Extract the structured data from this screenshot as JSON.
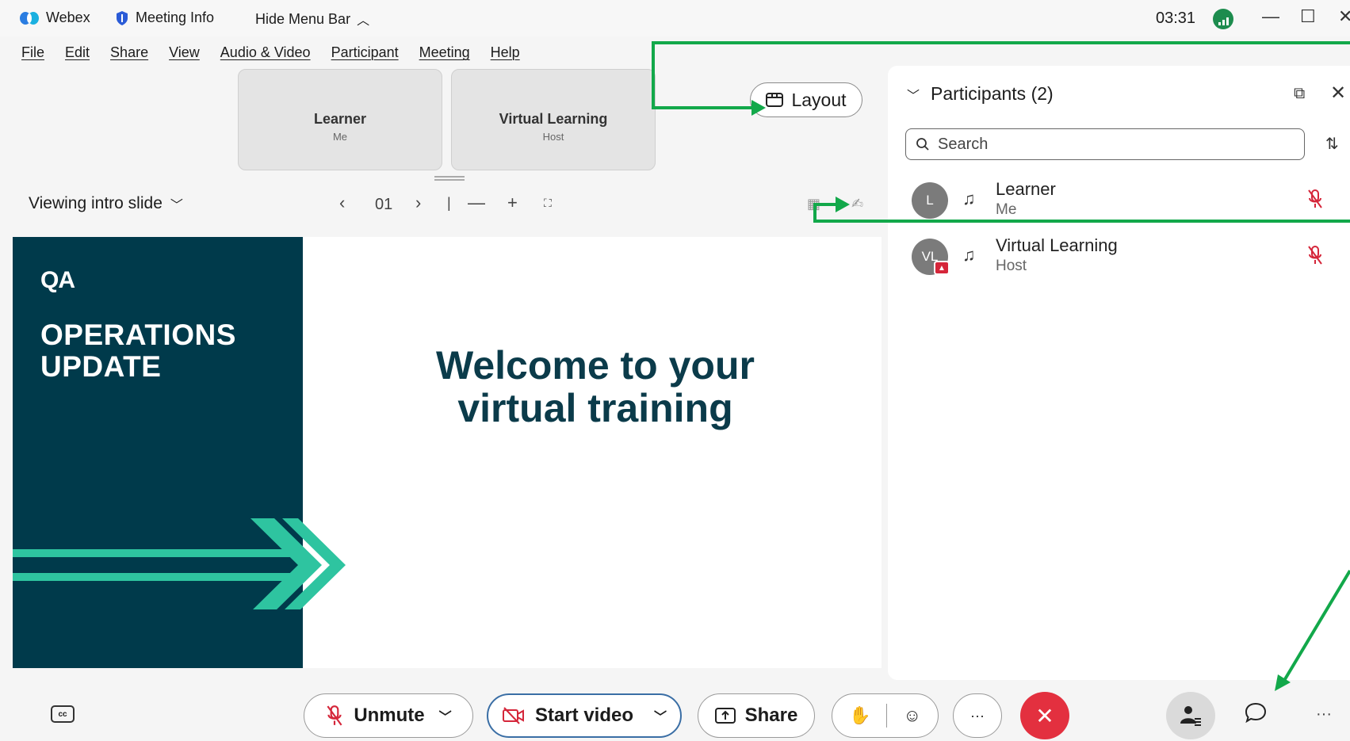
{
  "titlebar": {
    "app_name": "Webex",
    "meeting_info": "Meeting Info",
    "hide_menu": "Hide Menu Bar",
    "clock": "03:31"
  },
  "menu": [
    "File",
    "Edit",
    "Share",
    "View",
    "Audio & Video",
    "Participant",
    "Meeting",
    "Help"
  ],
  "tiles": [
    {
      "name": "Learner",
      "role": "Me"
    },
    {
      "name": "Virtual Learning",
      "role": "Host"
    }
  ],
  "layout_label": "Layout",
  "viewing": {
    "label": "Viewing intro slide",
    "page": "01"
  },
  "slide": {
    "logo": "QA",
    "title_line1": "OPERATIONS",
    "title_line2": "UPDATE",
    "welcome_line1": "Welcome to your",
    "welcome_line2": "virtual training",
    "brand_dark": "#003a4b",
    "accent": "#2ec4a0"
  },
  "participants": {
    "title": "Participants (2)",
    "search_placeholder": "Search",
    "list": [
      {
        "initials": "L",
        "name": "Learner",
        "role": "Me"
      },
      {
        "initials": "VL",
        "name": "Virtual Learning",
        "role": "Host"
      }
    ]
  },
  "bottom": {
    "unmute": "Unmute",
    "start_video": "Start video",
    "share": "Share",
    "more": "···",
    "end_color": "#e3303f"
  },
  "annotation_color": "#12a84a"
}
